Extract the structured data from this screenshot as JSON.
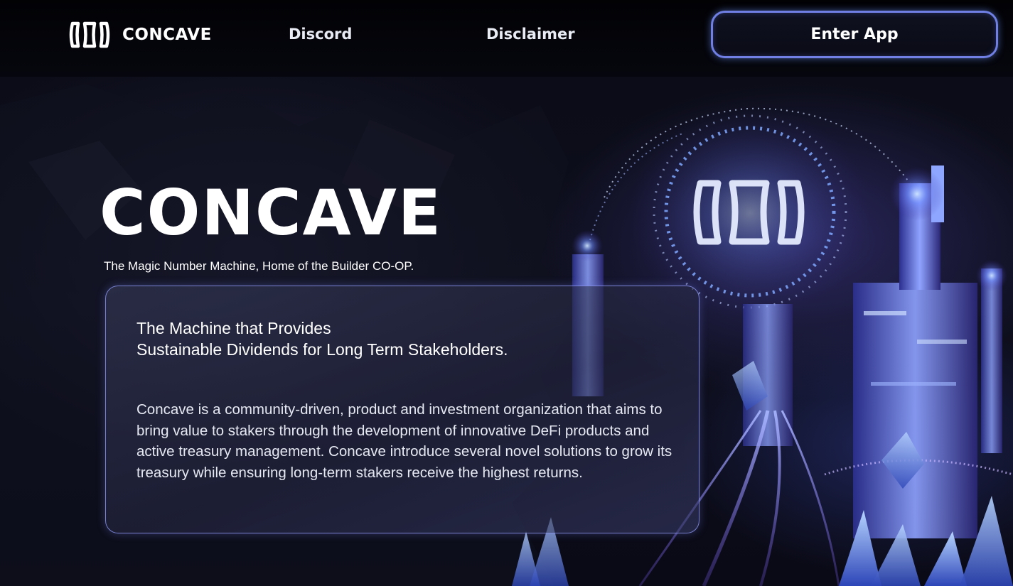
{
  "nav": {
    "logo_text": "CONCAVE",
    "links": [
      "Discord",
      "Disclaimer"
    ],
    "cta_label": "Enter App"
  },
  "hero": {
    "title": "CONCAVE",
    "tagline": "The Magic Number Machine, Home of the Builder CO-OP.",
    "card": {
      "heading_lines": [
        "The Machine that Provides",
        "Sustainable Dividends for Long Term Stakeholders."
      ],
      "body": "Concave is a community-driven, product and investment organization that aims to bring value to stakers through the development of innovative DeFi products and active treasury management. Concave introduce several novel solutions to grow its treasury while ensuring long-term stakers receive the highest returns."
    }
  },
  "icons": {
    "logo": "concave-logo-icon",
    "artwork": "crystal-machine-illustration"
  },
  "colors": {
    "accent": "#6f7fe4",
    "background": "#05060c",
    "card_border": "#969fff"
  }
}
